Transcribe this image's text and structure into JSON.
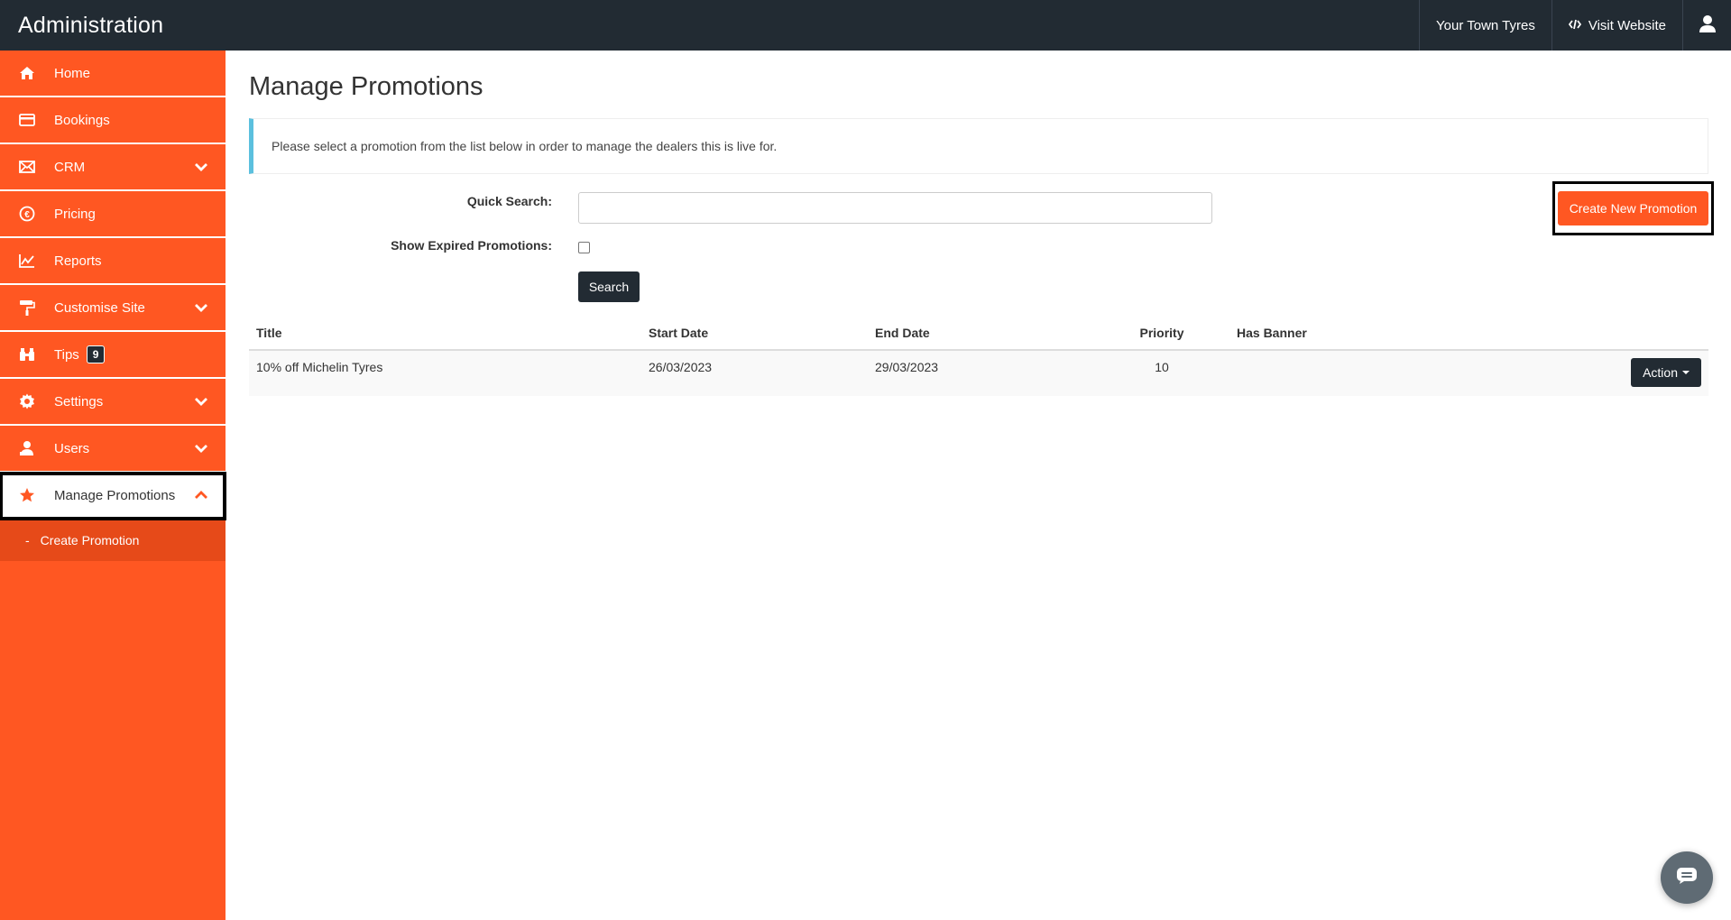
{
  "app": {
    "brand": "Administration",
    "accent_color": "#ff5722",
    "dark_color": "#222b33"
  },
  "topbar": {
    "dealer": "Your Town Tyres",
    "visit_website": "Visit Website",
    "visit_icon": "code-icon",
    "user_icon": "user-icon"
  },
  "sidebar": {
    "items": [
      {
        "label": "Home",
        "icon": "home-icon"
      },
      {
        "label": "Bookings",
        "icon": "credit-card-icon"
      },
      {
        "label": "CRM",
        "icon": "envelope-icon",
        "expandable": true
      },
      {
        "label": "Pricing",
        "icon": "euro-icon"
      },
      {
        "label": "Reports",
        "icon": "line-chart-icon"
      },
      {
        "label": "Customise Site",
        "icon": "paint-roller-icon",
        "expandable": true
      },
      {
        "label": "Tips",
        "icon": "binoculars-icon",
        "badge": "9"
      },
      {
        "label": "Settings",
        "icon": "gear-icon",
        "expandable": true
      },
      {
        "label": "Users",
        "icon": "user-group-icon",
        "expandable": true
      },
      {
        "label": "Manage Promotions",
        "icon": "star-icon",
        "expandable": true,
        "active": true
      }
    ],
    "sub_items": [
      {
        "bullet": "-",
        "label": "Create Promotion"
      }
    ]
  },
  "main": {
    "title": "Manage Promotions",
    "info": "Please select a promotion from the list below in order to manage the dealers this is live for.",
    "search_label": "Quick Search:",
    "search_value": "",
    "expired_label": "Show Expired Promotions:",
    "expired_checked": false,
    "search_button": "Search",
    "create_button": "Create New Promotion",
    "table": {
      "headers": [
        "Title",
        "Start Date",
        "End Date",
        "Priority",
        "Has Banner"
      ],
      "rows": [
        {
          "title": "10% off Michelin Tyres",
          "start": "26/03/2023",
          "end": "29/03/2023",
          "priority": "10",
          "banner": "",
          "action": "Action"
        }
      ]
    }
  }
}
